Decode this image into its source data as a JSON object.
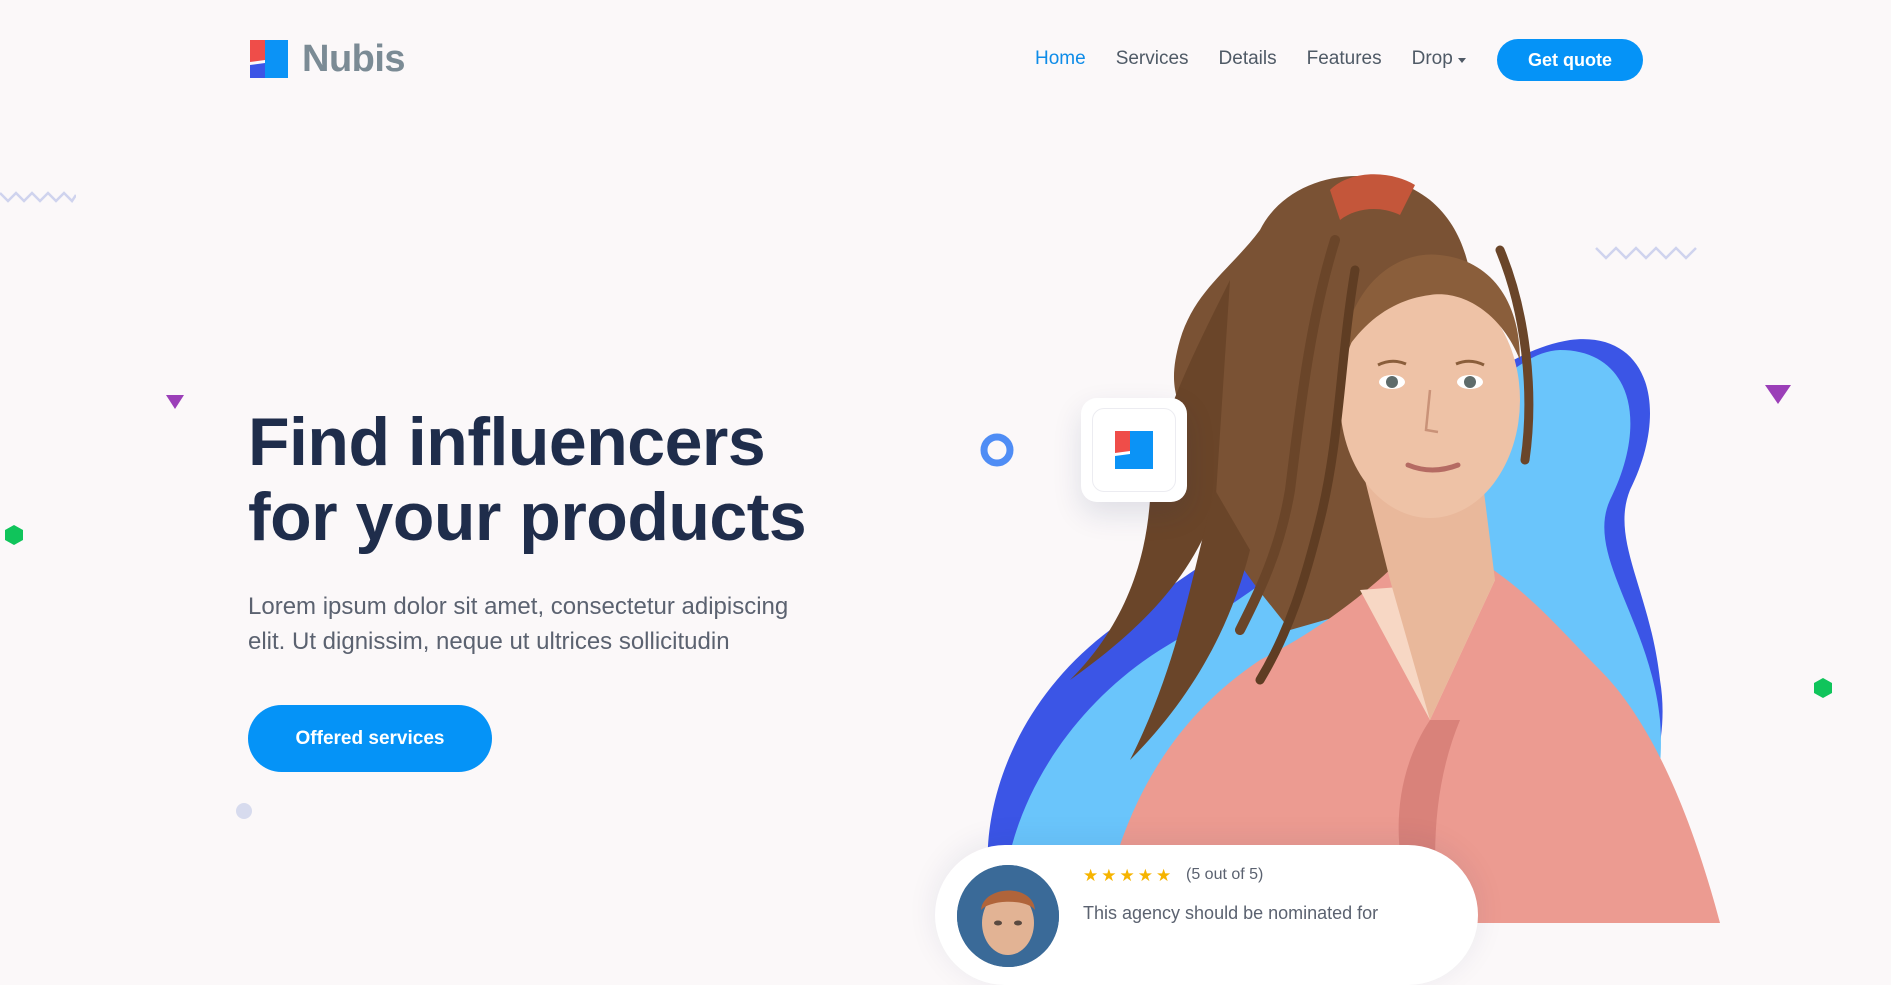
{
  "brand": {
    "name": "Nubis"
  },
  "nav": {
    "items": [
      {
        "label": "Home",
        "active": true
      },
      {
        "label": "Services",
        "active": false
      },
      {
        "label": "Details",
        "active": false
      },
      {
        "label": "Features",
        "active": false
      },
      {
        "label": "Drop",
        "active": false
      }
    ],
    "cta_label": "Get quote"
  },
  "hero": {
    "headline_line1": "Find influencers",
    "headline_line2": "for your products",
    "lead_line1": "Lorem ipsum dolor sit amet, consectetur adipiscing",
    "lead_line2": "elit. Ut dignissim, neque ut ultrices sollicitudin",
    "cta_label": "Offered services"
  },
  "review": {
    "rating_stars": 5,
    "rating_text": "(5 out of 5)",
    "text": "This agency should be nominated for"
  },
  "colors": {
    "accent": "#0593f7",
    "heading": "#1f2d4b",
    "body_text": "#5b6270",
    "nav_active": "#0e8ce8",
    "blob_light": "#6ac5fb",
    "blob_dark": "#3b55e6",
    "star": "#f6b400",
    "deco_purple": "#9b3fb8",
    "deco_green": "#10c45b"
  },
  "icons": {
    "logo": "nubis-logo-icon",
    "drop_caret": "chevron-down-icon",
    "star": "star-icon"
  }
}
